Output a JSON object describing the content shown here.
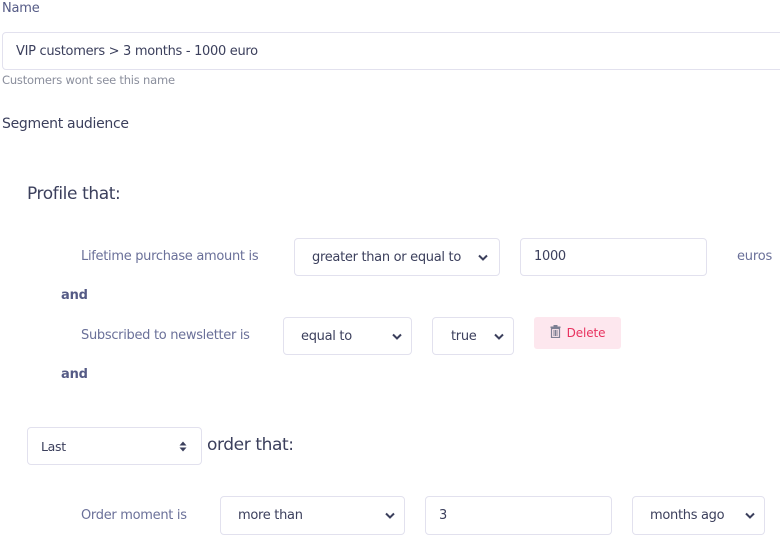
{
  "name_field": {
    "label": "Name",
    "value": "VIP customers > 3 months - 1000 euro",
    "hint": "Customers wont see this name"
  },
  "segment": {
    "title": "Segment audience",
    "profile_group": {
      "title": "Profile that:",
      "conditions": [
        {
          "label": "Lifetime purchase amount is",
          "operator": "greater than or equal to",
          "value": "1000",
          "unit": "euros"
        },
        {
          "label": "Subscribed to newsletter is",
          "operator": "equal to",
          "value": "true",
          "delete_label": "Delete"
        }
      ],
      "connectors": [
        "and",
        "and"
      ]
    },
    "order_group": {
      "selector": "Last",
      "title": "order that:",
      "conditions": [
        {
          "label": "Order moment is",
          "operator": "more than",
          "value": "3",
          "unit": "months ago"
        }
      ]
    }
  },
  "colors": {
    "delete_bg": "#fde7ee",
    "delete_text": "#e8325f",
    "border": "#e2e1ee",
    "label": "#6a7099"
  }
}
